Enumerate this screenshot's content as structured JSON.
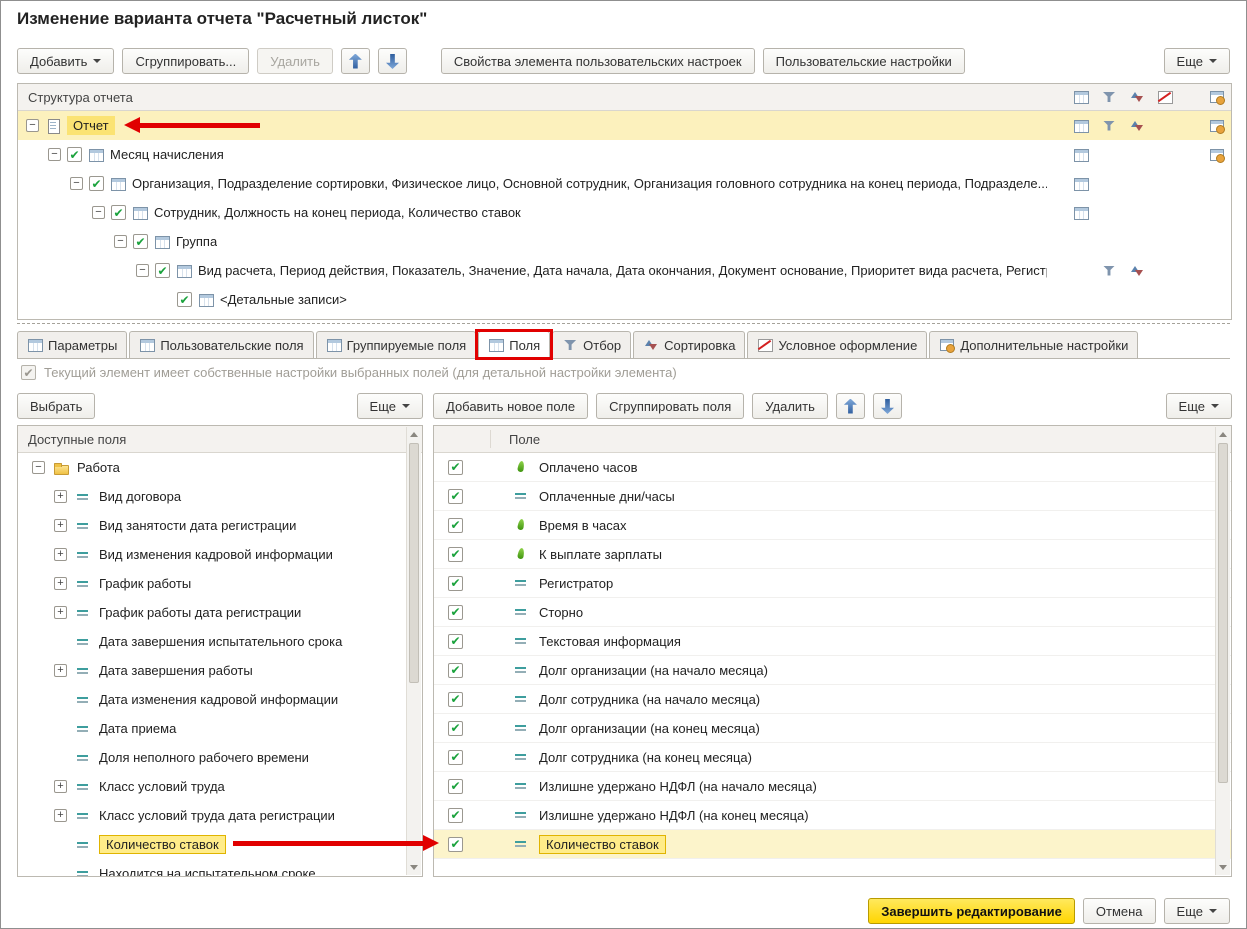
{
  "window": {
    "title": "Изменение варианта отчета \"Расчетный листок\""
  },
  "toolbar": {
    "add": "Добавить",
    "group": "Сгруппировать...",
    "delete": "Удалить",
    "element_props": "Свойства элемента пользовательских настроек",
    "user_settings": "Пользовательские настройки",
    "more": "Еще"
  },
  "structure": {
    "header": "Структура отчета",
    "rows": [
      {
        "label": "Отчет"
      },
      {
        "label": "Месяц начисления"
      },
      {
        "label": "Организация, Подразделение сортировки, Физическое лицо, Основной сотрудник, Организация головного сотрудника на конец периода, Подразделе..."
      },
      {
        "label": "Сотрудник, Должность на конец периода, Количество ставок"
      },
      {
        "label": "Группа"
      },
      {
        "label": "Вид расчета, Период действия, Показатель, Значение, Дата начала, Дата окончания, Документ основание, Приоритет вида расчета, Регистр..."
      },
      {
        "label": "<Детальные записи>"
      }
    ]
  },
  "tabs": [
    {
      "label": "Параметры"
    },
    {
      "label": "Пользовательские поля"
    },
    {
      "label": "Группируемые поля"
    },
    {
      "label": "Поля"
    },
    {
      "label": "Отбор"
    },
    {
      "label": "Сортировка"
    },
    {
      "label": "Условное оформление"
    },
    {
      "label": "Дополнительные настройки"
    }
  ],
  "own_settings_note": "Текущий элемент имеет собственные настройки выбранных полей (для детальной настройки элемента)",
  "available": {
    "select_button": "Выбрать",
    "more": "Еще",
    "header": "Доступные поля",
    "items": [
      {
        "label": "Работа"
      },
      {
        "label": "Вид договора"
      },
      {
        "label": "Вид занятости дата регистрации"
      },
      {
        "label": "Вид изменения кадровой информации"
      },
      {
        "label": "График работы"
      },
      {
        "label": "График работы дата регистрации"
      },
      {
        "label": "Дата завершения испытательного срока"
      },
      {
        "label": "Дата завершения работы"
      },
      {
        "label": "Дата изменения кадровой информации"
      },
      {
        "label": "Дата приема"
      },
      {
        "label": "Доля неполного рабочего времени"
      },
      {
        "label": "Класс условий труда"
      },
      {
        "label": "Класс условий труда дата регистрации"
      },
      {
        "label": "Количество ставок"
      },
      {
        "label": "Находится на испытательном сроке"
      }
    ]
  },
  "selected_fields": {
    "add_button": "Добавить новое поле",
    "group_button": "Сгруппировать поля",
    "delete_button": "Удалить",
    "more": "Еще",
    "header": "Поле",
    "rows": [
      {
        "label": "Оплачено часов"
      },
      {
        "label": "Оплаченные дни/часы"
      },
      {
        "label": "Время в часах"
      },
      {
        "label": "К выплате зарплаты"
      },
      {
        "label": "Регистратор"
      },
      {
        "label": "Сторно"
      },
      {
        "label": "Текстовая информация"
      },
      {
        "label": "Долг организации (на начало месяца)"
      },
      {
        "label": "Долг сотрудника (на начало месяца)"
      },
      {
        "label": "Долг организации (на конец месяца)"
      },
      {
        "label": "Долг сотрудника (на конец месяца)"
      },
      {
        "label": "Излишне удержано НДФЛ (на начало месяца)"
      },
      {
        "label": "Излишне удержано НДФЛ (на конец месяца)"
      },
      {
        "label": "Количество ставок"
      }
    ]
  },
  "footer": {
    "finish": "Завершить редактирование",
    "cancel": "Отмена",
    "more": "Еще"
  },
  "colors": {
    "highlight_row": "#fcf1bd",
    "highlight_cell": "#ffec89",
    "annotation_red": "#e10000",
    "check_green": "#1aa23c",
    "finish_yellow": "#ffd500"
  }
}
